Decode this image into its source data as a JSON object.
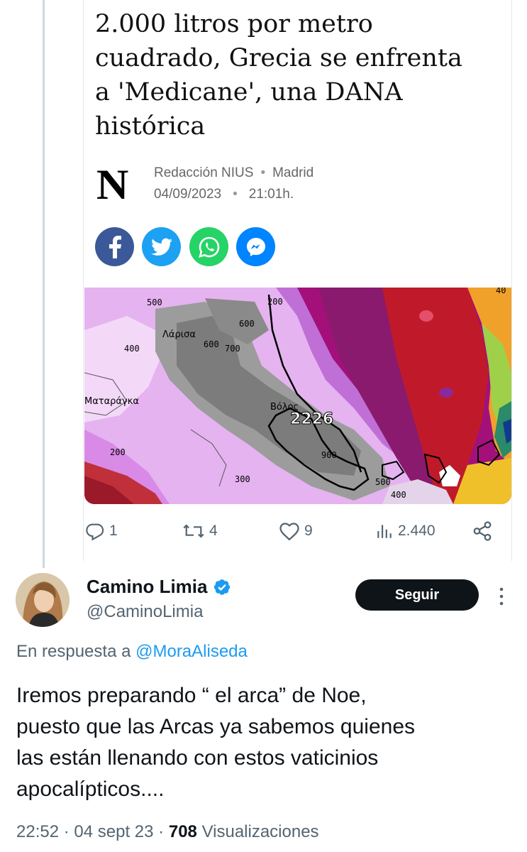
{
  "article": {
    "headline_lines": [
      "2.000 litros por metro",
      "cuadrado, Grecia se enfrenta",
      "a 'Medicane', una DANA",
      "histórica"
    ],
    "source_logo": "N",
    "author": "Redacción NIUS",
    "location": "Madrid",
    "date": "04/09/2023",
    "time": "21:01h.",
    "separator": "•",
    "share_buttons": [
      {
        "icon": "facebook-icon",
        "color": "#3b5998"
      },
      {
        "icon": "twitter-icon",
        "color": "#1da1f2"
      },
      {
        "icon": "whatsapp-icon",
        "color": "#25d366"
      },
      {
        "icon": "messenger-icon",
        "color": "#0084ff"
      }
    ],
    "map_labels": {
      "larisa": "Λάρισα",
      "volos": "Βόλος",
      "mataranga": "Ματαράγκα",
      "max_value": "2226",
      "contours": [
        "500",
        "600",
        "600",
        "700",
        "400",
        "200",
        "300",
        "900",
        "500",
        "400",
        "200",
        "40"
      ]
    }
  },
  "quoted_actions": {
    "replies": "1",
    "retweets": "4",
    "likes": "9",
    "views": "2.440"
  },
  "reply": {
    "display_name": "Camino Limia",
    "handle": "@CaminoLimia",
    "follow_label": "Seguir",
    "reply_prefix": "En respuesta a",
    "reply_mention": "@MoraAliseda",
    "text_lines": [
      "Iremos preparando “ el arca” de Noe,",
      "puesto que las Arcas ya sabemos quienes",
      "las están llenando con estos vaticinios",
      "apocalípticos...."
    ],
    "time": "22:52",
    "date": "04 sept 23",
    "views_count": "708",
    "views_label": "Visualizaciones",
    "meta_sep": "·"
  },
  "colors": {
    "accent": "#1d9bf0",
    "text_secondary": "#536471",
    "follow_bg": "#0f1419",
    "verified": "#1d9bf0"
  }
}
